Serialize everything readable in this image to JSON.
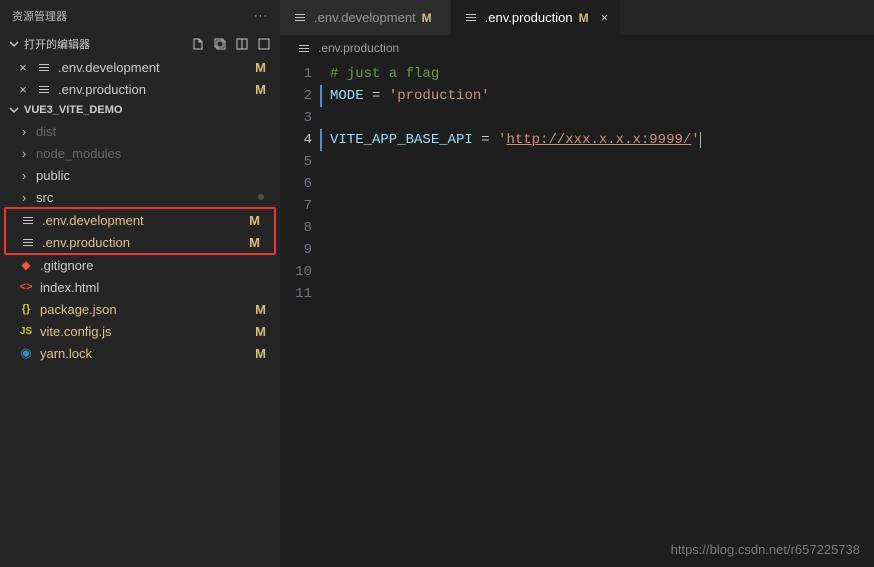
{
  "sidebar": {
    "title": "资源管理器",
    "open_editors_label": "打开的编辑器",
    "editors": [
      {
        "name": ".env.development",
        "badge": "M"
      },
      {
        "name": ".env.production",
        "badge": "M"
      }
    ],
    "project_name": "VUE3_VITE_DEMO",
    "tree": [
      {
        "type": "folder",
        "name": "dist",
        "dim": true
      },
      {
        "type": "folder",
        "name": "node_modules",
        "dim": true
      },
      {
        "type": "folder",
        "name": "public"
      },
      {
        "type": "folder",
        "name": "src",
        "dot": true
      }
    ],
    "highlighted": [
      {
        "name": ".env.development",
        "badge": "M"
      },
      {
        "name": ".env.production",
        "badge": "M"
      }
    ],
    "rest": [
      {
        "icon": "git",
        "name": ".gitignore"
      },
      {
        "icon": "html",
        "name": "index.html"
      },
      {
        "icon": "json",
        "name": "package.json",
        "badge": "M"
      },
      {
        "icon": "js",
        "name": "vite.config.js",
        "badge": "M"
      },
      {
        "icon": "yarn",
        "name": "yarn.lock",
        "badge": "M"
      }
    ]
  },
  "tabs": [
    {
      "name": ".env.development",
      "badge": "M",
      "active": false
    },
    {
      "name": ".env.production",
      "badge": "M",
      "active": true
    }
  ],
  "breadcrumb": ".env.production",
  "code": {
    "lines": [
      {
        "n": 1,
        "type": "comment",
        "text": "# just a flag"
      },
      {
        "n": 2,
        "type": "assign",
        "var": "MODE",
        "val": "'production'",
        "border": true
      },
      {
        "n": 3,
        "type": "empty"
      },
      {
        "n": 4,
        "type": "assign",
        "var": "VITE_APP_BASE_API",
        "val_pre": "'",
        "val_link": "http://xxx.x.x.x:9999/",
        "val_post": "'",
        "border": true,
        "hl": true,
        "current": true
      },
      {
        "n": 5,
        "type": "empty"
      },
      {
        "n": 6,
        "type": "empty"
      },
      {
        "n": 7,
        "type": "empty"
      },
      {
        "n": 8,
        "type": "empty"
      },
      {
        "n": 9,
        "type": "empty"
      },
      {
        "n": 10,
        "type": "empty"
      },
      {
        "n": 11,
        "type": "empty"
      }
    ]
  },
  "watermark": "https://blog.csdn.net/r657225738"
}
